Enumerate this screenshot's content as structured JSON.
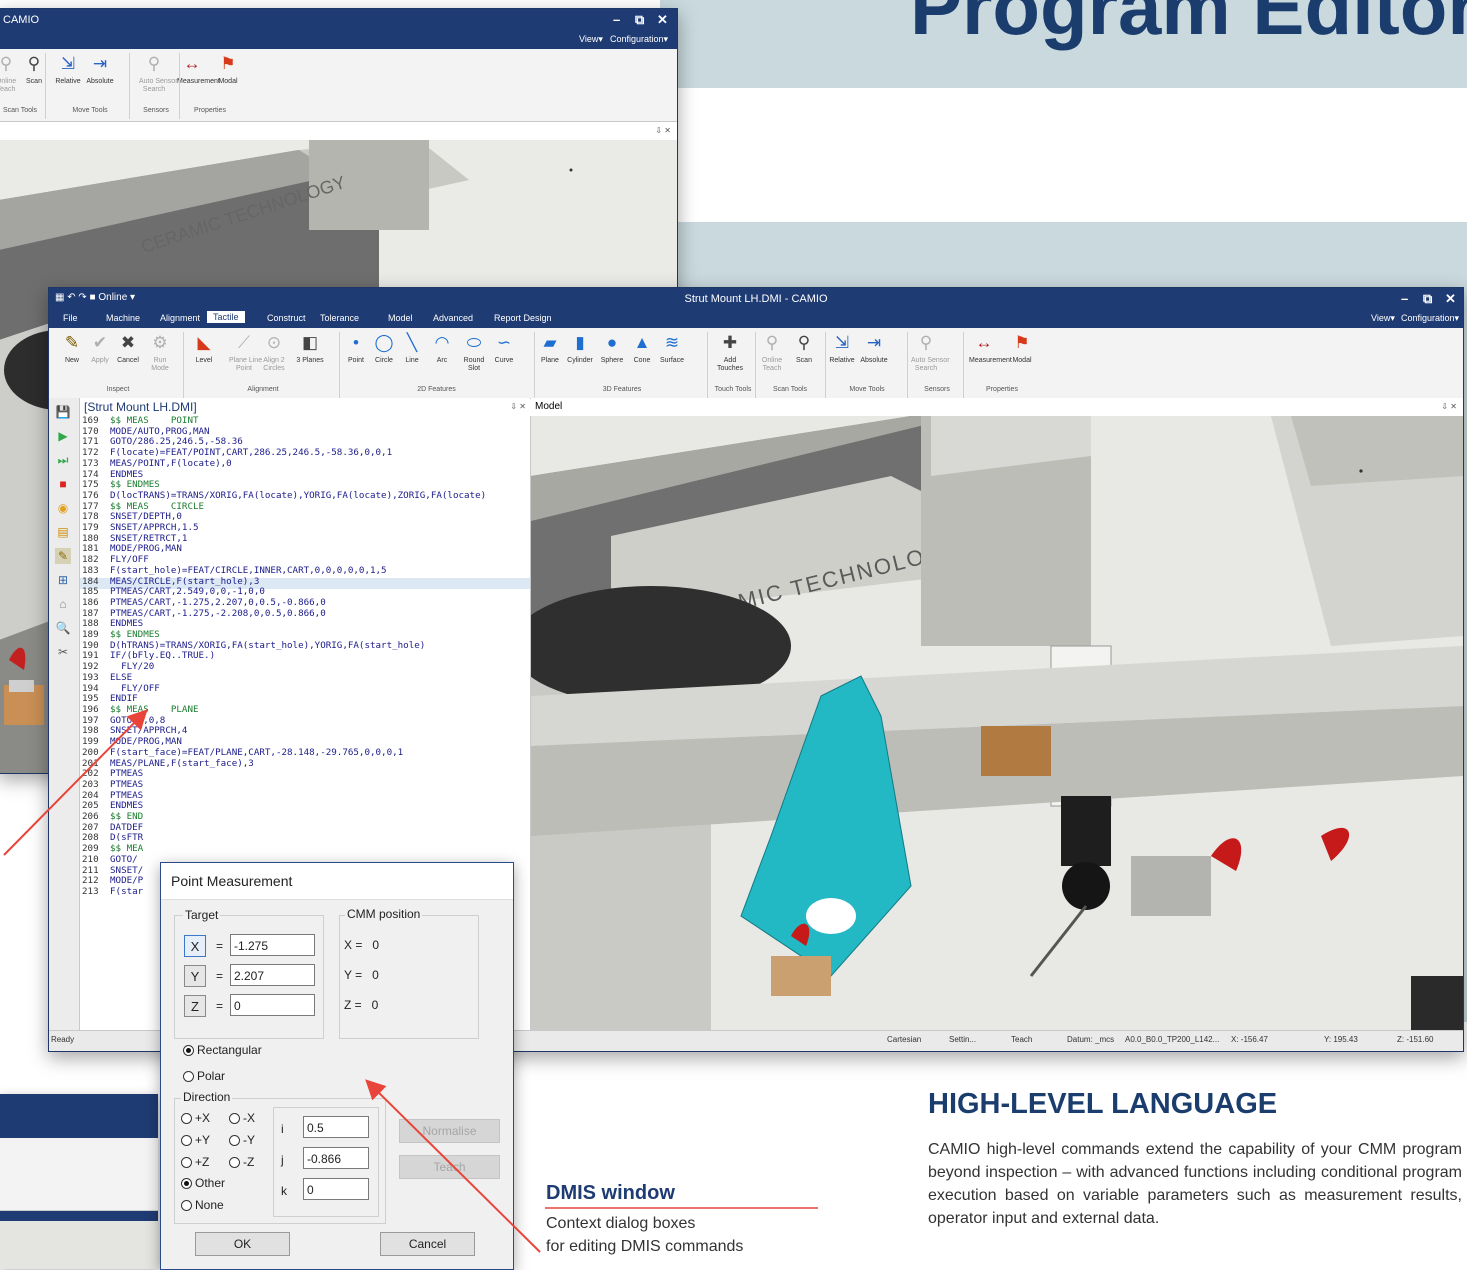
{
  "headline": "Program Editor",
  "back_window": {
    "title": "CAMIO",
    "view_menu": "View▾",
    "config_menu": "Configuration▾",
    "ribbon": [
      {
        "label": "Online\nTeach",
        "icon": "online-teach-icon",
        "disabled": true
      },
      {
        "label": "Scan",
        "icon": "scan-icon"
      },
      {
        "label": "Relative",
        "icon": "relative-move-icon"
      },
      {
        "label": "Absolute",
        "icon": "absolute-move-icon"
      },
      {
        "label": "Auto Sensor\nSearch",
        "icon": "auto-sensor-icon",
        "disabled": true
      },
      {
        "label": "Measurement",
        "icon": "measurement-icon"
      },
      {
        "label": "Modal",
        "icon": "modal-icon"
      }
    ],
    "groups": [
      "Scan Tools",
      "Move Tools",
      "Sensors",
      "Properties"
    ],
    "pin": "⇩ ✕",
    "model_text": "CERAMIC TECHNOLOGY"
  },
  "main_window": {
    "title": "Strut Mount LH.DMI  -  CAMIO",
    "quick_access": "Online",
    "view_menu": "View▾",
    "config_menu": "Configuration▾",
    "tabs": [
      "File",
      "Machine",
      "Alignment",
      "Tactile",
      "Construct",
      "Tolerance",
      "Model",
      "Advanced",
      "Report Design"
    ],
    "active_tab": "Tactile",
    "ribbon": [
      {
        "label": "New",
        "icon": "new-icon"
      },
      {
        "label": "Apply",
        "icon": "apply-check-icon",
        "disabled": true
      },
      {
        "label": "Cancel",
        "icon": "cancel-x-icon"
      },
      {
        "label": "Run\nMode",
        "icon": "run-mode-icon",
        "disabled": true
      },
      {
        "label": "Level",
        "icon": "level-icon"
      },
      {
        "label": "Plane Line\nPoint",
        "icon": "plane-line-point-icon",
        "disabled": true
      },
      {
        "label": "Align 2\nCircles",
        "icon": "align-circles-icon",
        "disabled": true
      },
      {
        "label": "3 Planes",
        "icon": "three-planes-icon"
      },
      {
        "label": "Point",
        "icon": "point-icon"
      },
      {
        "label": "Circle",
        "icon": "circle-icon"
      },
      {
        "label": "Line",
        "icon": "line-icon"
      },
      {
        "label": "Arc",
        "icon": "arc-icon"
      },
      {
        "label": "Round\nSlot",
        "icon": "round-slot-icon"
      },
      {
        "label": "Curve",
        "icon": "curve-icon"
      },
      {
        "label": "Plane",
        "icon": "plane-icon"
      },
      {
        "label": "Cylinder",
        "icon": "cylinder-icon"
      },
      {
        "label": "Sphere",
        "icon": "sphere-icon"
      },
      {
        "label": "Cone",
        "icon": "cone-icon"
      },
      {
        "label": "Surface",
        "icon": "surface-icon"
      },
      {
        "label": "Add\nTouches",
        "icon": "add-touches-icon"
      },
      {
        "label": "Online\nTeach",
        "icon": "online-teach-icon",
        "disabled": true
      },
      {
        "label": "Scan",
        "icon": "scan-icon"
      },
      {
        "label": "Relative",
        "icon": "relative-move-icon"
      },
      {
        "label": "Absolute",
        "icon": "absolute-move-icon"
      },
      {
        "label": "Auto Sensor\nSearch",
        "icon": "auto-sensor-icon",
        "disabled": true
      },
      {
        "label": "Measurement",
        "icon": "measurement-icon"
      },
      {
        "label": "Modal",
        "icon": "modal-icon"
      }
    ],
    "groups": [
      "Inspect",
      "Alignment",
      "2D Features",
      "3D Features",
      "Touch Tools",
      "Scan Tools",
      "Move Tools",
      "Sensors",
      "Properties"
    ],
    "editor_title": "[Strut Mount LH.DMI]",
    "editor_pin": "⇩ ✕",
    "model_title": "Model",
    "model_pin": "⇩ ✕",
    "model_text": "CERAMIC TECHNOLOGY",
    "code_lines": [
      {
        "n": "169",
        "t": "$$ MEAS    POINT"
      },
      {
        "n": "170",
        "t": "MODE/AUTO,PROG,MAN"
      },
      {
        "n": "171",
        "t": "GOTO/286.25,246.5,-58.36"
      },
      {
        "n": "172",
        "t": "F(locate)=FEAT/POINT,CART,286.25,246.5,-58.36,0,0,1"
      },
      {
        "n": "173",
        "t": "MEAS/POINT,F(locate),0"
      },
      {
        "n": "174",
        "t": "ENDMES"
      },
      {
        "n": "175",
        "t": "$$ ENDMES"
      },
      {
        "n": "176",
        "t": "D(locTRANS)=TRANS/XORIG,FA(locate),YORIG,FA(locate),ZORIG,FA(locate)"
      },
      {
        "n": "177",
        "t": "$$ MEAS    CIRCLE"
      },
      {
        "n": "178",
        "t": "SNSET/DEPTH,0"
      },
      {
        "n": "179",
        "t": "SNSET/APPRCH,1.5"
      },
      {
        "n": "180",
        "t": "SNSET/RETRCT,1"
      },
      {
        "n": "181",
        "t": "MODE/PROG,MAN"
      },
      {
        "n": "182",
        "t": "FLY/OFF"
      },
      {
        "n": "183",
        "t": "F(start_hole)=FEAT/CIRCLE,INNER,CART,0,0,0,0,0,1,5"
      },
      {
        "n": "184",
        "t": "MEAS/CIRCLE,F(start_hole),3"
      },
      {
        "n": "185",
        "t": "PTMEAS/CART,2.549,0,0,-1,0,0"
      },
      {
        "n": "186",
        "t": "PTMEAS/CART,-1.275,2.207,0,0.5,-0.866,0"
      },
      {
        "n": "187",
        "t": "PTMEAS/CART,-1.275,-2.208,0,0.5,0.866,0"
      },
      {
        "n": "188",
        "t": "ENDMES"
      },
      {
        "n": "189",
        "t": "$$ ENDMES"
      },
      {
        "n": "190",
        "t": "D(hTRANS)=TRANS/XORIG,FA(start_hole),YORIG,FA(start_hole)"
      },
      {
        "n": "191",
        "t": "IF/(bFly.EQ..TRUE.)"
      },
      {
        "n": "192",
        "t": "  FLY/20"
      },
      {
        "n": "193",
        "t": "ELSE"
      },
      {
        "n": "194",
        "t": "  FLY/OFF"
      },
      {
        "n": "195",
        "t": "ENDIF"
      },
      {
        "n": "196",
        "t": "$$ MEAS    PLANE"
      },
      {
        "n": "197",
        "t": "GOTO/0,0,8"
      },
      {
        "n": "198",
        "t": "SNSET/APPRCH,4"
      },
      {
        "n": "199",
        "t": "MODE/PROG,MAN"
      },
      {
        "n": "200",
        "t": "F(start_face)=FEAT/PLANE,CART,-28.148,-29.765,0,0,0,1"
      },
      {
        "n": "201",
        "t": "MEAS/PLANE,F(start_face),3"
      },
      {
        "n": "202",
        "t": "PTMEAS"
      },
      {
        "n": "203",
        "t": "PTMEAS"
      },
      {
        "n": "204",
        "t": "PTMEAS"
      },
      {
        "n": "205",
        "t": "ENDMES"
      },
      {
        "n": "206",
        "t": "$$ END"
      },
      {
        "n": "207",
        "t": "DATDEF"
      },
      {
        "n": "208",
        "t": "D(sFTR"
      },
      {
        "n": "209",
        "t": "$$ MEA"
      },
      {
        "n": "210",
        "t": "GOTO/"
      },
      {
        "n": "211",
        "t": "SNSET/"
      },
      {
        "n": "212",
        "t": "MODE/P"
      },
      {
        "n": "213",
        "t": "F(star"
      }
    ],
    "status": {
      "ready": "Ready",
      "coord_mode": "Cartesian",
      "settings": "Settin...",
      "teach": "Teach",
      "datum": "Datum: _mcs",
      "probe": "A0.0_B0.0_TP200_L142...",
      "x": "X: -156.47",
      "y": "Y: 195.43",
      "z": "Z: -151.60"
    }
  },
  "dialog": {
    "title": "Point Measurement",
    "target_label": "Target",
    "cmm_label": "CMM position",
    "x_btn": "X",
    "y_btn": "Y",
    "z_btn": "Z",
    "eq": "=",
    "x_value": "-1.275",
    "y_value": "2.207",
    "z_value": "0",
    "cmm_x": "X =   0",
    "cmm_y": "Y =   0",
    "cmm_z": "Z =   0",
    "rectangular": "Rectangular",
    "polar": "Polar",
    "direction_label": "Direction",
    "dir_options": [
      "+X",
      "-X",
      "+Y",
      "-Y",
      "+Z",
      "-Z"
    ],
    "other": "Other",
    "none": "None",
    "i_label": "i",
    "j_label": "j",
    "k_label": "k",
    "i_value": "0.5",
    "j_value": "-0.866",
    "k_value": "0",
    "normalise": "Normalise",
    "teach": "Teach",
    "ok": "OK",
    "cancel": "Cancel"
  },
  "caption": {
    "title": "DMIS window",
    "line1": "Context dialog boxes",
    "line2": "for editing DMIS commands"
  },
  "hll": {
    "title": "HIGH-LEVEL LANGUAGE",
    "body": "CAMIO high-level commands extend the capability of your CMM program beyond inspection – with advanced functions including conditional program execution based on variable parameters such as measurement results, operator input and external data."
  },
  "colors": {
    "titlebar": "#1f3b73",
    "accent_red": "#e8443a",
    "headline": "#1b3d6e",
    "caption_title": "#1f3b73",
    "band": "#c9d9de",
    "part_cyan": "#22b8c4"
  }
}
